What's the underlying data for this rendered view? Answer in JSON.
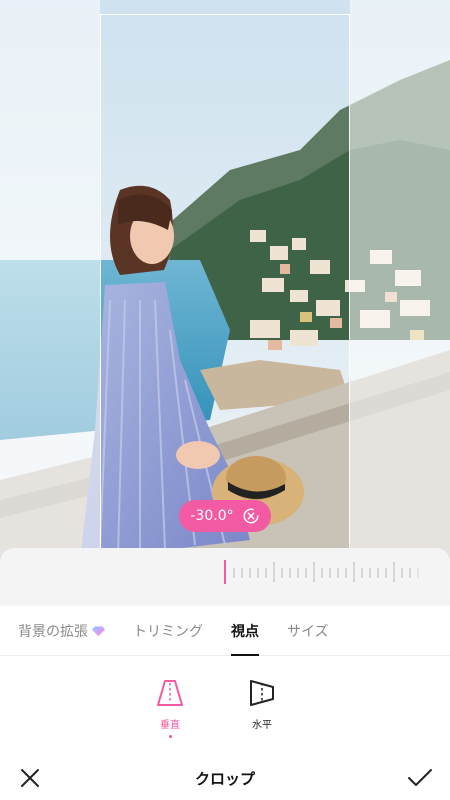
{
  "editor": {
    "angle_value": "-30.0°"
  },
  "tabs": [
    {
      "label": "背景の拡張",
      "premium": true
    },
    {
      "label": "トリミング"
    },
    {
      "label": "視点",
      "active": true
    },
    {
      "label": "サイズ"
    }
  ],
  "options": [
    {
      "label": "垂直",
      "active": true
    },
    {
      "label": "水平"
    }
  ],
  "bottom_bar": {
    "title": "クロップ"
  },
  "colors": {
    "accent": "#f25aa3",
    "sea": "#4aa3c9",
    "sky": "#dbe9f3"
  },
  "icons": {
    "cancel": "close-icon",
    "confirm": "check-icon",
    "reset": "reset-angle-icon",
    "vertical": "vertical-perspective-icon",
    "horizontal": "horizontal-perspective-icon",
    "premium": "gem-icon"
  }
}
